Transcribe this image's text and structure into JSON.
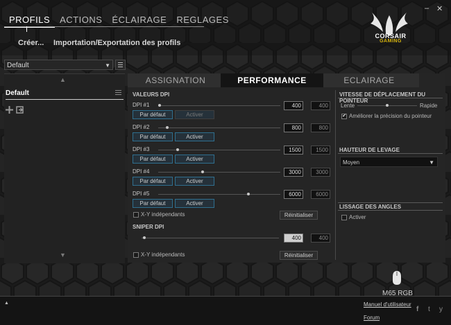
{
  "nav": {
    "items": [
      "PROFILS",
      "ACTIONS",
      "ÉCLAIRAGE",
      "REGLAGES"
    ],
    "active": 0
  },
  "sub_links": {
    "create": "Créer...",
    "import_export": "Importation/Exportation des profils"
  },
  "window": {
    "minimize": "–",
    "close": "✕"
  },
  "logo": {
    "line1": "CORSAIR",
    "line2": "GAMING"
  },
  "profile_select": {
    "value": "Default",
    "arrow": "▼"
  },
  "left_panel": {
    "profile_name": "Default",
    "scroll_up": "▲",
    "scroll_down": "▼"
  },
  "tabs": [
    "ASSIGNATION",
    "PERFORMANCE",
    "ECLAIRAGE"
  ],
  "active_tab": 1,
  "dpi": {
    "title": "VALEURS DPI",
    "default_label": "Par défaut",
    "activate_label": "Activer",
    "stages": [
      {
        "label": "DPI #1",
        "value": "400",
        "value2": "400",
        "level": 0.0
      },
      {
        "label": "DPI #2",
        "value": "800",
        "value2": "800",
        "level": 0.06
      },
      {
        "label": "DPI #3",
        "value": "1500",
        "value2": "1500",
        "level": 0.15
      },
      {
        "label": "DPI #4",
        "value": "3000",
        "value2": "3000",
        "level": 0.35
      },
      {
        "label": "DPI #5",
        "value": "6000",
        "value2": "6000",
        "level": 0.73
      }
    ],
    "xy_label": "X-Y indépendants",
    "reset_label": "Réinitialiser"
  },
  "sniper": {
    "title": "SNIPER DPI",
    "value": "400",
    "value2": "400",
    "level": 0.0,
    "xy_label": "X-Y indépendants",
    "reset_label": "Réinitialiser"
  },
  "pointer_speed": {
    "title": "VITESSE DE DÉPLACEMENT DU POINTEUR",
    "slow": "Lente",
    "fast": "Rapide",
    "level": 0.5,
    "precision_label": "Améliorer la précision du pointeur",
    "precision_checked": true,
    "check_mark": "✔"
  },
  "lift_height": {
    "title": "HAUTEUR DE LEVAGE",
    "value": "Moyen",
    "arrow": "▼"
  },
  "angle_snapping": {
    "title": "LISSAGE DES ANGLES",
    "activate_label": "Activer"
  },
  "device": {
    "name": "M65 RGB"
  },
  "bottom": {
    "expand": "▲",
    "manual": "Manuel d'utilisateur",
    "forum": "Forum",
    "social": [
      "f",
      "t",
      "y"
    ]
  },
  "colors": {
    "accent_border": "#2f6f8f",
    "logo_gold": "#d6b40c"
  }
}
